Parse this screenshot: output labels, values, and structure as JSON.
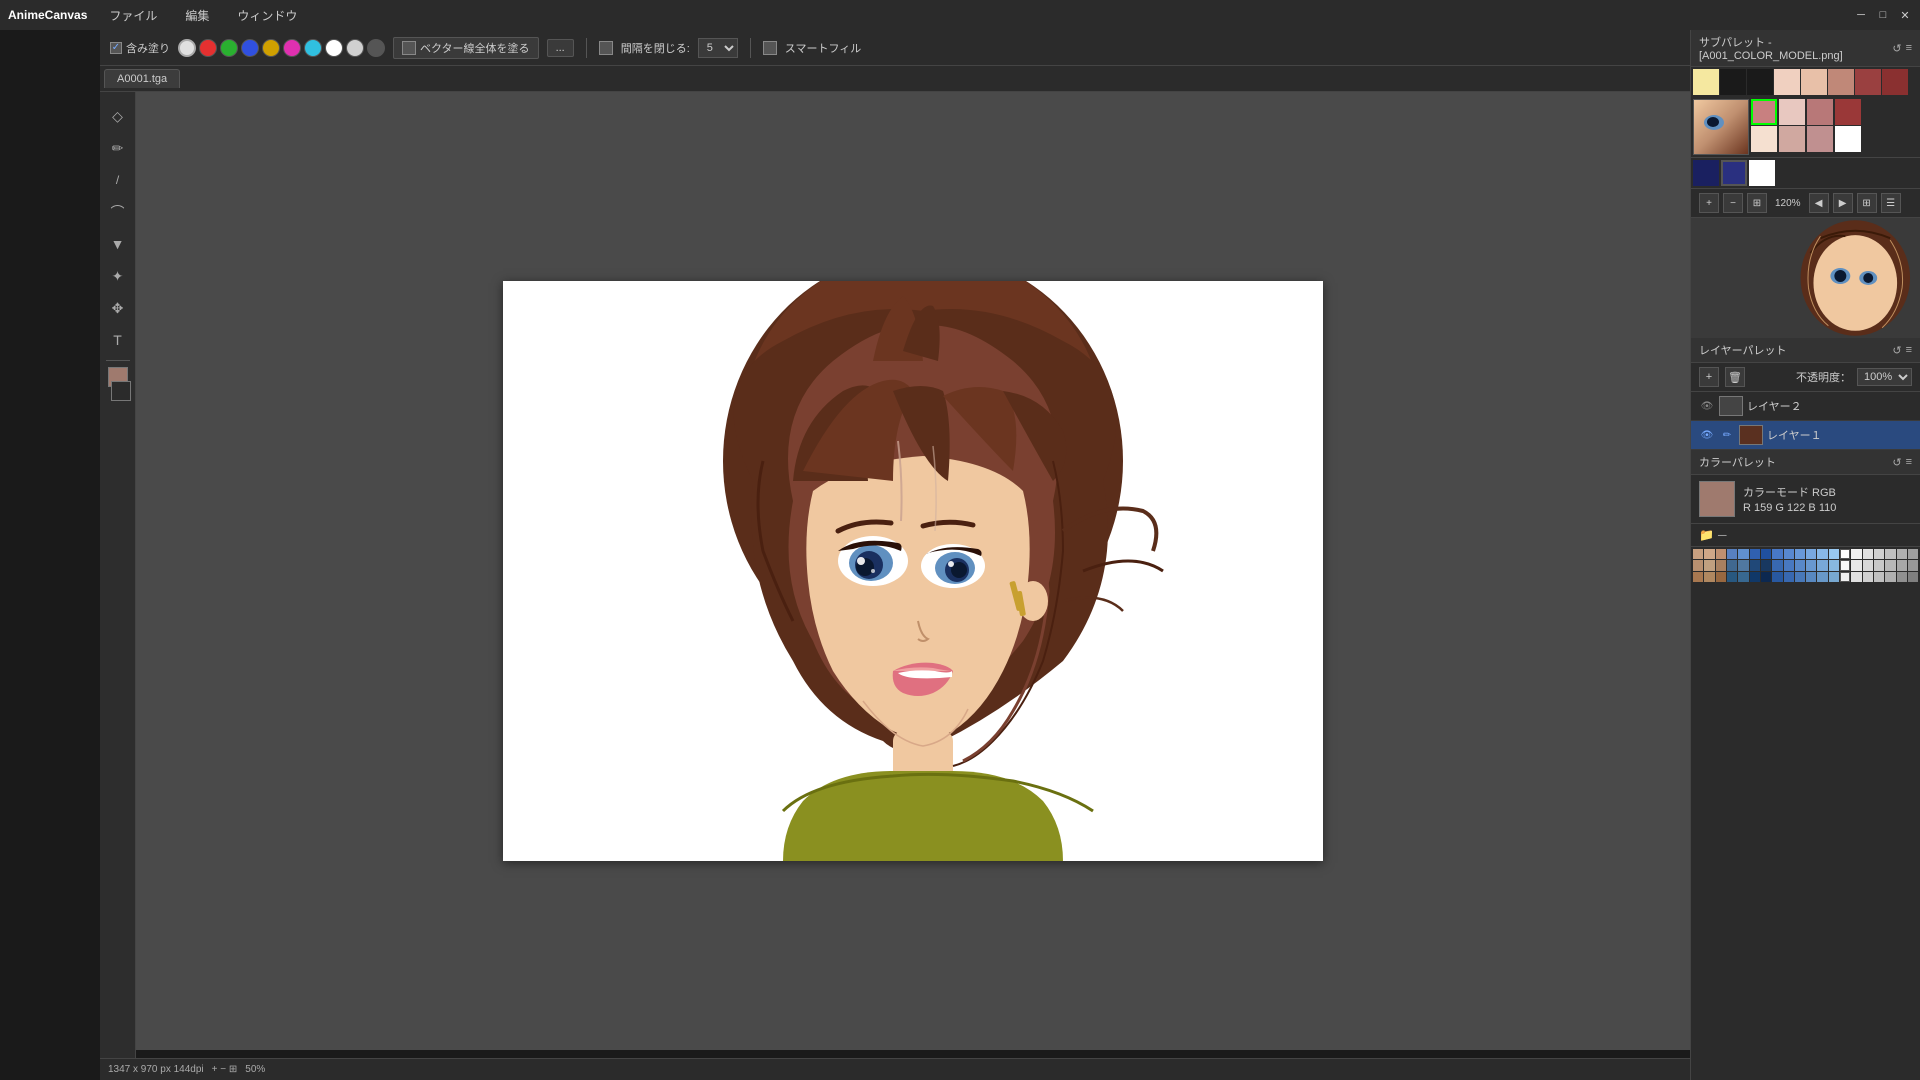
{
  "app": {
    "name": "AnimeCanvas",
    "title": "AnimeCanvas",
    "file_menu": "ファイル",
    "edit_menu": "編集",
    "window_menu": "ウィンドウ"
  },
  "toolbar": {
    "fill_label": "含み塗り",
    "vector_btn": "ベクター線全体を塗る",
    "more_btn": "...",
    "close_label": "間隔を閉じる:",
    "close_value": "5",
    "smart_label": "スマートフィル",
    "colors": [
      {
        "id": "c1",
        "hex": "#e8e8e8"
      },
      {
        "id": "c2",
        "hex": "#e53030"
      },
      {
        "id": "c3",
        "hex": "#2ab030"
      },
      {
        "id": "c4",
        "hex": "#3050e0"
      },
      {
        "id": "c5",
        "hex": "#d0a000"
      },
      {
        "id": "c6",
        "hex": "#e030b0"
      },
      {
        "id": "c7",
        "hex": "#30c0e0"
      },
      {
        "id": "c8",
        "hex": "#ffffff"
      },
      {
        "id": "c9",
        "hex": "#e0e0e0"
      },
      {
        "id": "c10",
        "hex": "#555555"
      }
    ]
  },
  "tab": {
    "label": "A0001.tga"
  },
  "canvas": {
    "width": "1347",
    "height": "970",
    "dpi": "144dpi",
    "zoom": "50%"
  },
  "sub_palette": {
    "title": "サブパレット - [A001_COLOR_MODEL.png]",
    "colors_row1": [
      "#f5e8a0",
      "#1a1a1a",
      "#1a1a1a",
      "#f0d0c0",
      "#e8c0a8",
      "#c08878",
      "#a06050",
      "#9a4040"
    ],
    "colors_row2": [
      "#c8c0b8",
      "#888080",
      "#6a6060",
      "#f0e8e0",
      "#d8c8c0",
      "#b0a0a0",
      "#886868",
      "#704040"
    ],
    "preview_colors_top": [
      "#f5e8a0",
      "#5090d0",
      "#2060b0",
      "#3070b0",
      "#204080",
      "#e8e0d0"
    ]
  },
  "layer_palette": {
    "title": "レイヤーパレット",
    "opacity_label": "不透明度：",
    "opacity_value": "100%",
    "layers": [
      {
        "name": "レイヤー２",
        "selected": false,
        "visible": true
      },
      {
        "name": "レイヤー１",
        "selected": true,
        "visible": true
      }
    ]
  },
  "color_palette": {
    "title": "カラーパレット",
    "mode": "RGB",
    "mode_label": "カラーモード",
    "r": 159,
    "g": 122,
    "b": 110,
    "current_color": "#9f7a6e",
    "r_label": "R 159",
    "g_label": "G 122",
    "b_label": "B 110"
  },
  "status": {
    "dimensions": "1347 x 970 px  144dpi",
    "zoom": "50%"
  },
  "tools": [
    {
      "name": "magnify",
      "icon": "🔍"
    },
    {
      "name": "rotate",
      "icon": "↺"
    },
    {
      "name": "select",
      "icon": "◇"
    },
    {
      "name": "pen",
      "icon": "✏"
    },
    {
      "name": "pencil2",
      "icon": "/"
    },
    {
      "name": "brush",
      "icon": "⌒"
    },
    {
      "name": "fill",
      "icon": "▼"
    },
    {
      "name": "eyedropper",
      "icon": "✦"
    },
    {
      "name": "move",
      "icon": "✥"
    },
    {
      "name": "text",
      "icon": "T"
    }
  ],
  "palette_nav": {
    "zoom_level": "120%",
    "play_icon": "▶",
    "prev_icon": "◀",
    "next_icon": "▶",
    "grid_icon": "⊞",
    "list_icon": "☰"
  }
}
